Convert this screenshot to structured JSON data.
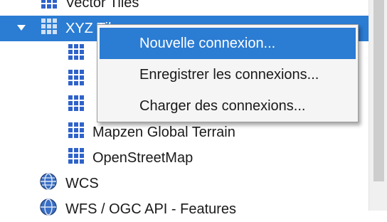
{
  "tree": {
    "items": [
      {
        "label": "Vector Tiles",
        "icon": "vector-tiles-icon"
      },
      {
        "label": "XYZ Tiles",
        "icon": "xyz-tiles-icon",
        "expanded": true,
        "selected": true
      },
      {
        "label": "",
        "icon": "xyz-layer-icon"
      },
      {
        "label": "",
        "icon": "xyz-layer-icon"
      },
      {
        "label": "",
        "icon": "xyz-layer-icon"
      },
      {
        "label": "Mapzen Global Terrain",
        "icon": "xyz-layer-icon"
      },
      {
        "label": "OpenStreetMap",
        "icon": "xyz-layer-icon"
      },
      {
        "label": "WCS",
        "icon": "wcs-globe-icon"
      },
      {
        "label": "WFS / OGC API - Features",
        "icon": "wfs-globe-icon"
      }
    ]
  },
  "context_menu": {
    "items": [
      {
        "label": "Nouvelle connexion...",
        "highlighted": true
      },
      {
        "label": "Enregistrer les connexions..."
      },
      {
        "label": "Charger des connexions..."
      }
    ]
  },
  "colors": {
    "selection": "#2b7cd3",
    "menu_bg": "#f5f5f5",
    "tile_icon": "#2f63c9"
  }
}
